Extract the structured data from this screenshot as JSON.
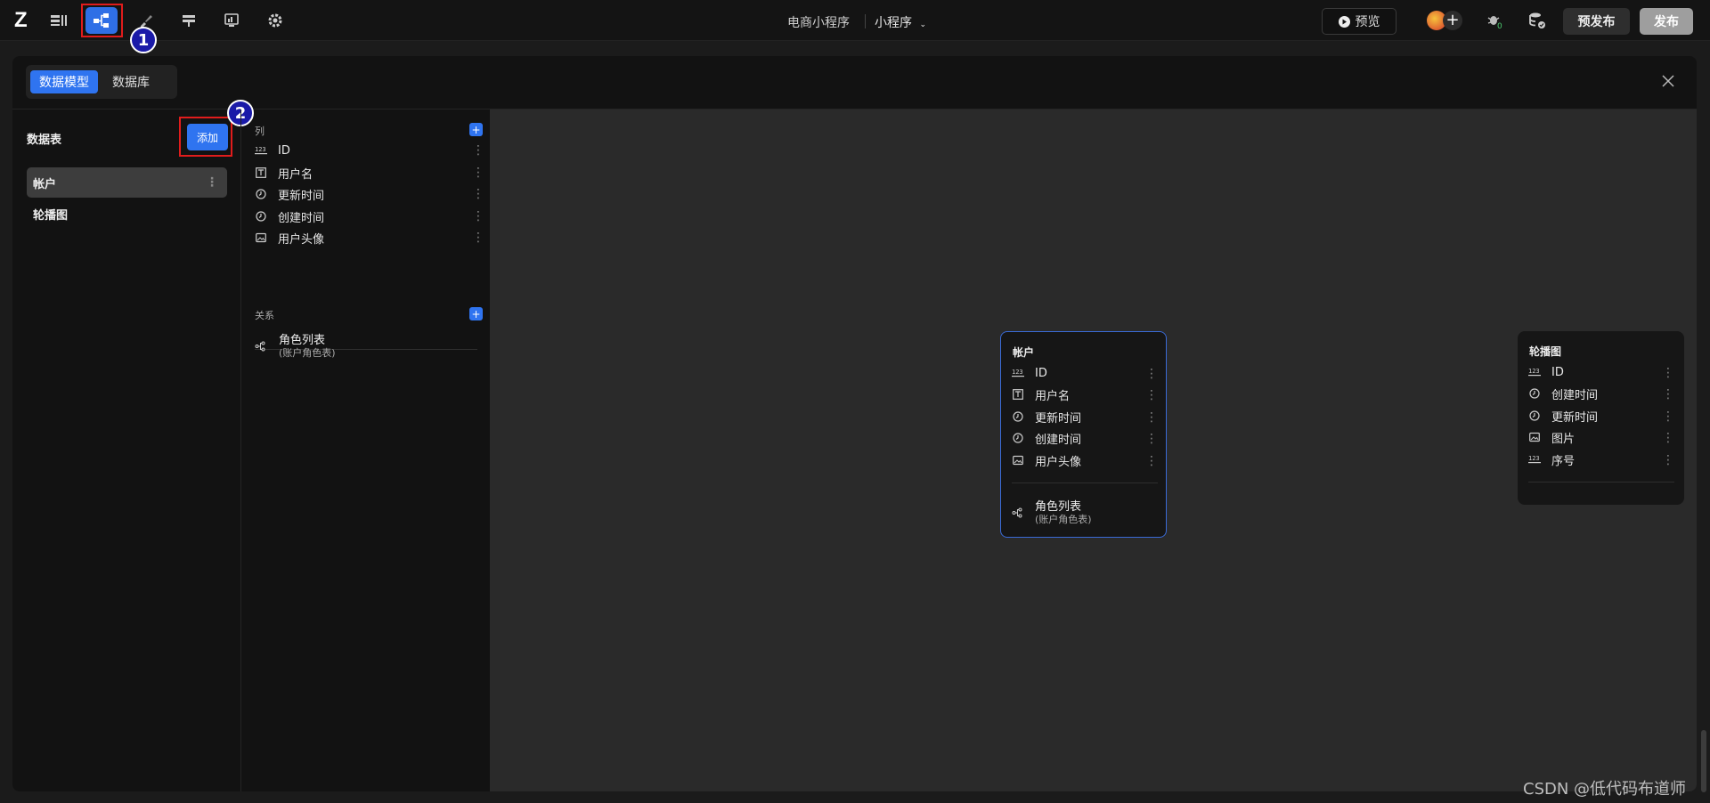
{
  "topbar": {
    "logo": "Z",
    "app_name": "电商小程序",
    "env_name": "小程序",
    "preview_label": "预览",
    "prepublish_label": "预发布",
    "publish_label": "发布",
    "markers": [
      "1",
      "2"
    ]
  },
  "panel": {
    "tabs": [
      "数据模型",
      "数据库"
    ],
    "tables_label": "数据表",
    "add_label": "添加",
    "tables": [
      "帐户",
      "轮播图"
    ]
  },
  "detail": {
    "columns_label": "列",
    "fields": [
      {
        "name": "ID",
        "icon": "number-icon"
      },
      {
        "name": "用户名",
        "icon": "text-field-icon"
      },
      {
        "name": "更新时间",
        "icon": "clock-icon"
      },
      {
        "name": "创建时间",
        "icon": "clock-icon"
      },
      {
        "name": "用户头像",
        "icon": "image-icon"
      }
    ],
    "relations_label": "关系",
    "relations": [
      {
        "name": "角色列表",
        "sub": "(账户角色表)",
        "icon": "relation-icon"
      }
    ]
  },
  "diagram": {
    "cards": [
      {
        "title": "帐户",
        "fields": [
          "ID",
          "用户名",
          "更新时间",
          "创建时间",
          "用户头像"
        ],
        "relation": {
          "name": "角色列表",
          "sub": "(账户角色表)"
        }
      },
      {
        "title": "轮播图",
        "fields": [
          "ID",
          "创建时间",
          "更新时间",
          "图片",
          "序号"
        ]
      }
    ]
  },
  "watermark": "CSDN @低代码布道师",
  "colors": {
    "accent": "#2f74f0",
    "highlight": "#e01c1c",
    "marker": "#1a1aa8"
  }
}
